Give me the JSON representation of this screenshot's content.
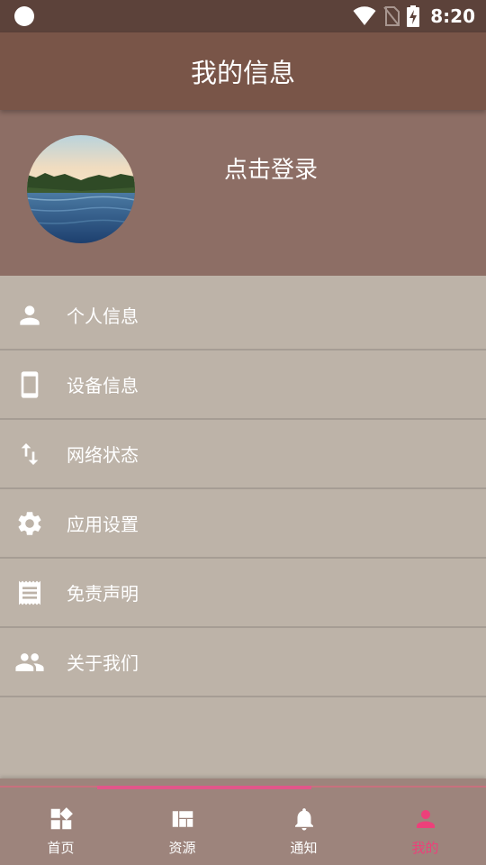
{
  "status_bar": {
    "time": "8:20"
  },
  "app_bar": {
    "title": "我的信息"
  },
  "profile": {
    "login_label": "点击登录"
  },
  "menu": {
    "items": [
      {
        "label": "个人信息",
        "icon": "person-icon"
      },
      {
        "label": "设备信息",
        "icon": "phone-icon"
      },
      {
        "label": "网络状态",
        "icon": "swap-vert-icon"
      },
      {
        "label": "应用设置",
        "icon": "gear-icon"
      },
      {
        "label": "免责声明",
        "icon": "receipt-icon"
      },
      {
        "label": "关于我们",
        "icon": "people-icon"
      }
    ]
  },
  "bottom_nav": {
    "items": [
      {
        "label": "首页",
        "icon": "widgets-icon"
      },
      {
        "label": "资源",
        "icon": "dashboard-icon"
      },
      {
        "label": "通知",
        "icon": "bell-icon"
      },
      {
        "label": "我的",
        "icon": "person-icon",
        "active": true
      }
    ]
  },
  "colors": {
    "status_bar": "#5c423a",
    "app_bar": "#795548",
    "profile_bg": "#8d6e65",
    "list_bg": "#bdb3a8",
    "bottom_nav_bg": "#9d847c",
    "accent": "#ec407a"
  }
}
